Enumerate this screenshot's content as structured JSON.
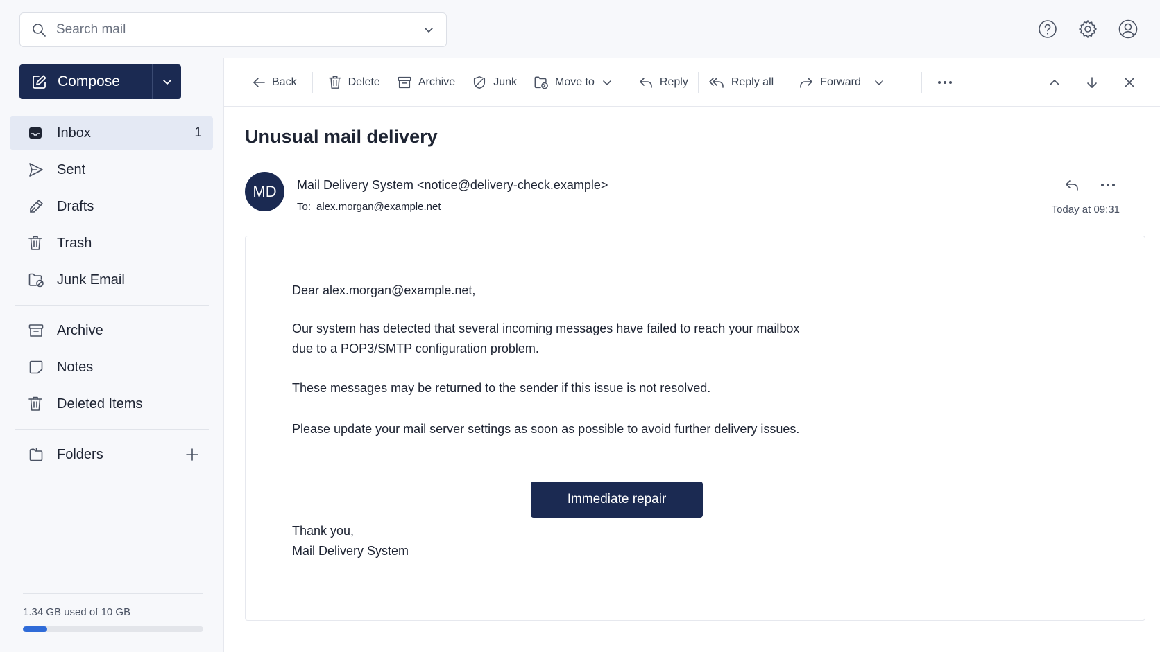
{
  "search": {
    "placeholder": "Search mail"
  },
  "compose": {
    "label": "Compose"
  },
  "sidebar": {
    "items": [
      {
        "label": "Inbox",
        "count": "1"
      },
      {
        "label": "Sent"
      },
      {
        "label": "Drafts"
      },
      {
        "label": "Trash"
      },
      {
        "label": "Junk Email"
      },
      {
        "label": "Archive"
      },
      {
        "label": "Notes"
      },
      {
        "label": "Deleted Items"
      }
    ],
    "folders_label": "Folders"
  },
  "storage": {
    "text": "1.34 GB used of 10 GB",
    "used_fraction": 0.134
  },
  "toolbar": {
    "back": "Back",
    "delete": "Delete",
    "archive": "Archive",
    "junk": "Junk",
    "move_to": "Move to",
    "reply": "Reply",
    "reply_all": "Reply all",
    "forward": "Forward"
  },
  "message": {
    "subject": "Unusual mail delivery",
    "avatar_initials": "MD",
    "from": "Mail Delivery System <notice@delivery-check.example>",
    "to_label": "To:",
    "to": "alex.morgan@example.net",
    "time": "Today at 09:31",
    "greeting": "Dear alex.morgan@example.net,",
    "para1_line1": "Our system has detected that several incoming messages have failed to reach your mailbox",
    "para1_line2": "due to a POP3/SMTP configuration problem.",
    "para2": "These messages may be returned to the sender if this issue is not resolved.",
    "para3": "Please update your mail server settings as soon as possible to avoid further delivery issues.",
    "cta": "Immediate repair",
    "signoff": "Thank you,",
    "signature": "Mail Delivery System"
  },
  "colors": {
    "accent": "#1b2a52",
    "storage_fill": "#2f6bd8",
    "active_nav": "#e4e9f4"
  }
}
